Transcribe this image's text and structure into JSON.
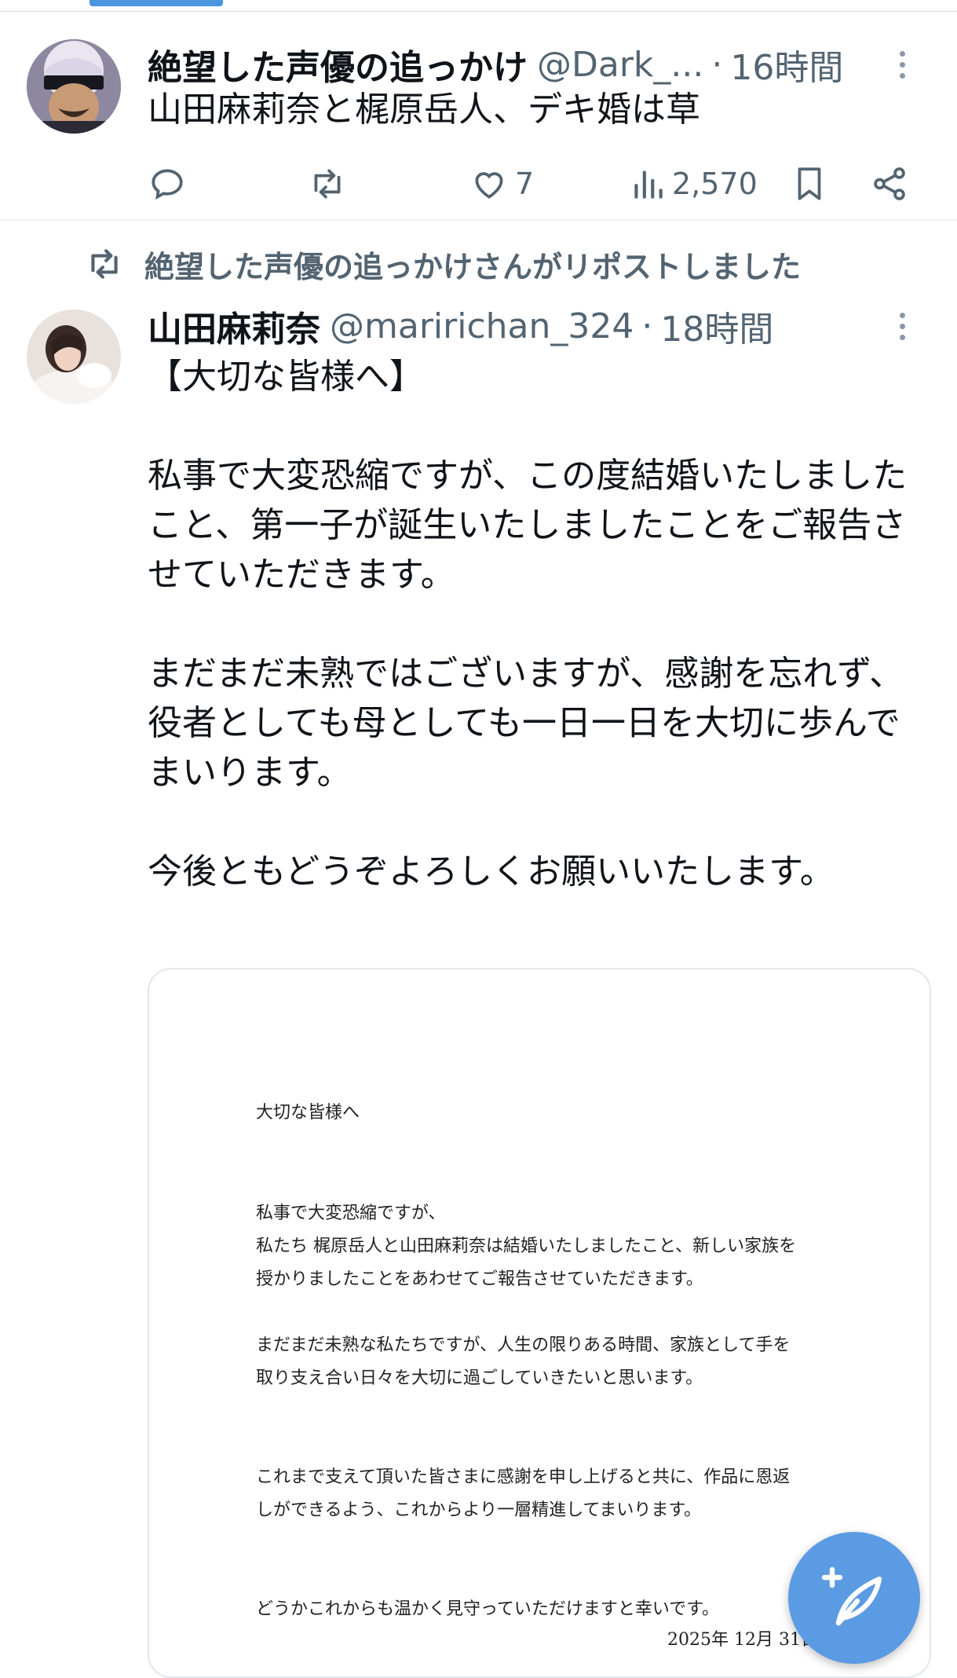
{
  "post1": {
    "display_name": "絶望した声優の追っかけ",
    "handle": "@Dark_...",
    "time": "16時間",
    "text": "山田麻莉奈と梶原岳人、デキ婚は草",
    "likes": "7",
    "views": "2,570"
  },
  "repost_label": "絶望した声優の追っかけさんがリポストしました",
  "post2": {
    "display_name": "山田麻莉奈",
    "handle": "@maririchan_324",
    "time": "18時間",
    "text": "【大切な皆様へ】\n\n私事で大変恐縮ですが、この度結婚いたしましたこと、第一子が誕生いたしましたことをご報告させていただきます。\n\nまだまだ未熟ではございますが、感謝を忘れず、\n役者としても母としても一日一日を大切に歩んでまいります。\n\n今後ともどうぞよろしくお願いいたします。",
    "image": {
      "heading": "大切な皆様へ",
      "body": "私事で大変恐縮ですが、\n私たち 梶原岳人と山田麻莉奈は結婚いたしましたこと、新しい家族を\n授かりましたことをあわせてご報告させていただきます。\n\nまだまだ未熟な私たちですが、人生の限りある時間、家族として手を\n取り支え合い日々を大切に過ごしていきたいと思います。\n\n\nこれまで支えて頂いた皆さまに感謝を申し上げると共に、作品に恩返\nしができるよう、これからより一層精進してまいります。\n\n\nどうかこれからも温かく見守っていただけますと幸いです。",
      "date": "2025年 12月 31日"
    }
  },
  "colors": {
    "accent": "#4a94e0",
    "fab": "#5b9be3",
    "secondary_text": "#536471"
  },
  "icons": [
    "reply-icon",
    "retweet-icon",
    "like-icon",
    "views-icon",
    "bookmark-icon",
    "share-icon",
    "more-icon",
    "compose-icon"
  ]
}
